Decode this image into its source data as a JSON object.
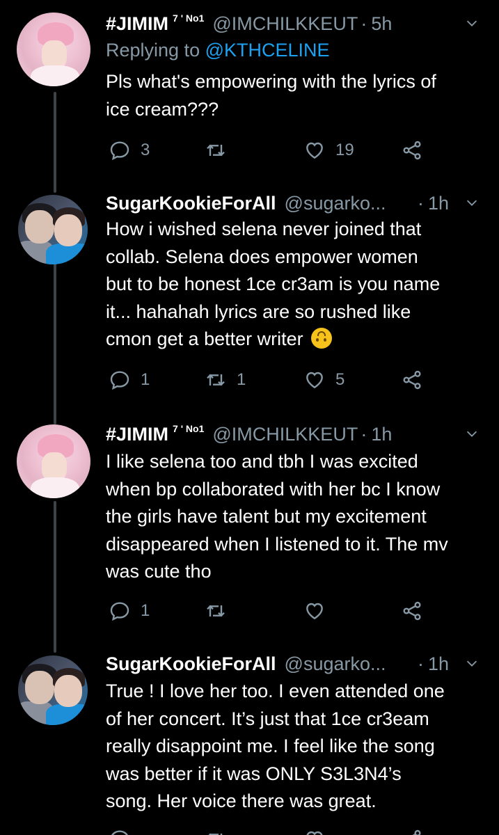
{
  "tweets": [
    {
      "name": "#JIMIM",
      "badge": "7 ' No1",
      "handle": "@IMCHILKKEUT",
      "dot": "·",
      "time": "5h",
      "replying_label": "Replying to",
      "replying_handle": "@KTHCELINE",
      "lines": [
        "Pls what's empowering with the lyrics of",
        "ice cream???"
      ],
      "reply_count": "3",
      "retweet_count": "",
      "like_count": "19"
    },
    {
      "name": "SugarKookieForAll",
      "handle": "@sugarko...",
      "dot": "·",
      "time": "1h",
      "lines": [
        "How i wished selena never joined that",
        "collab. Selena does empower women",
        "but to be honest 1ce cr3am is you name",
        "it... hahahah lyrics are so rushed like",
        "cmon get a better writer"
      ],
      "reply_count": "1",
      "retweet_count": "1",
      "like_count": "5"
    },
    {
      "name": "#JIMIM",
      "badge": "7 ' No1",
      "handle": "@IMCHILKKEUT",
      "dot": "·",
      "time": "1h",
      "lines": [
        "I like selena too and tbh I was excited",
        "when bp collaborated with her bc I know",
        "the girls have talent but my excitement",
        "disappeared when I listened to it. The mv",
        "was cute tho"
      ],
      "reply_count": "1",
      "retweet_count": "",
      "like_count": ""
    },
    {
      "name": "SugarKookieForAll",
      "handle": "@sugarko...",
      "dot": "·",
      "time": "1h",
      "lines": [
        "True ! I love her too. I even attended one",
        "of her concert. It’s just that 1ce cr3eam",
        "really disappoint me. I feel like the song",
        "was better if it was ONLY S3L3N4’s",
        "song. Her voice there was great."
      ]
    }
  ],
  "icons": {
    "reply": "reply-icon",
    "retweet": "retweet-icon",
    "like": "heart-icon",
    "share": "share-icon",
    "more": "chevron-down-icon",
    "emoji": "upside-down-face-emoji"
  },
  "colors": {
    "background": "#000000",
    "secondary_text": "#8899a6",
    "link": "#1da1f2",
    "thread_line": "#3d4349"
  }
}
